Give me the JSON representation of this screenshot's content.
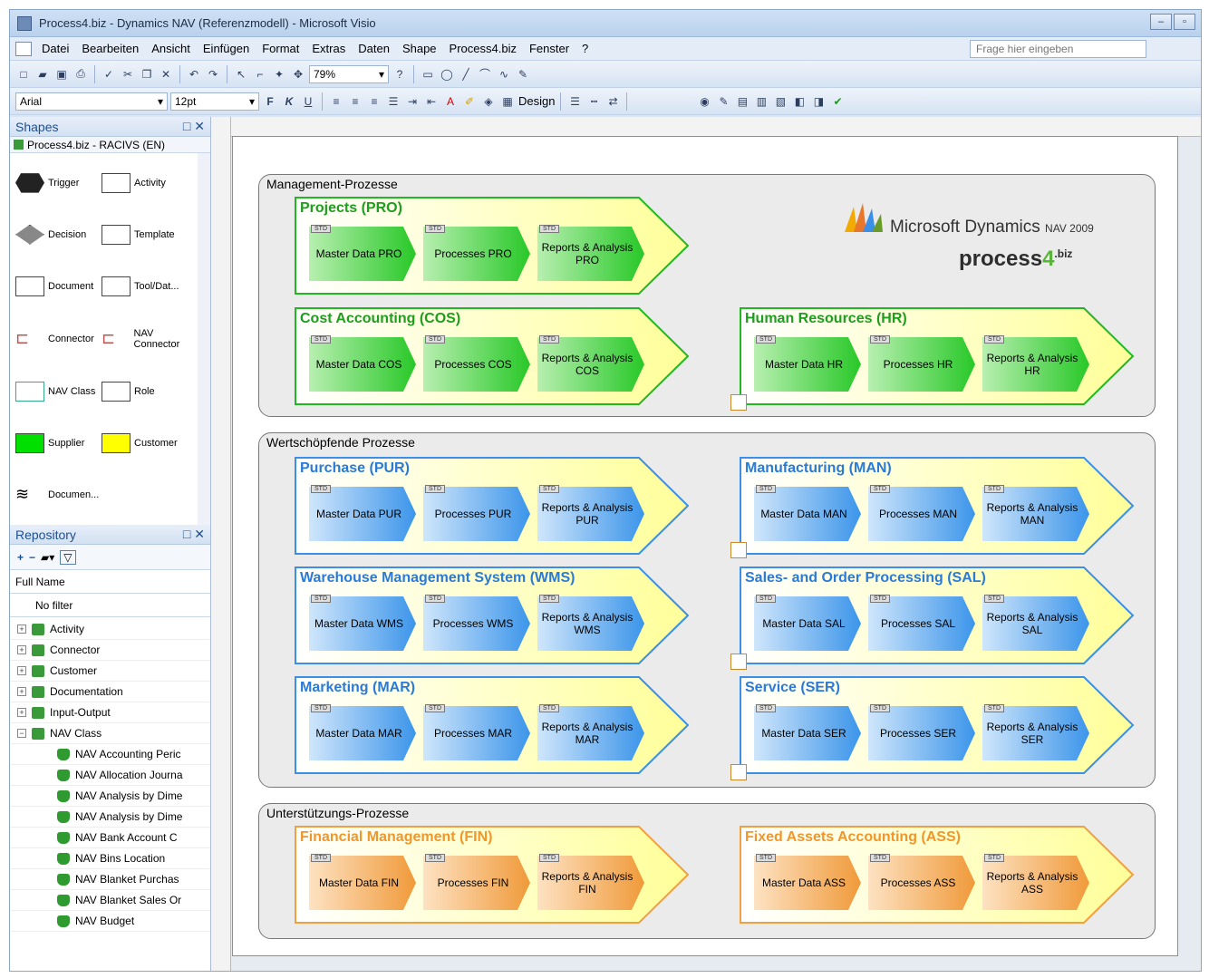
{
  "window": {
    "title": "Process4.biz - Dynamics NAV (Referenzmodell) - Microsoft Visio"
  },
  "menu": [
    "Datei",
    "Bearbeiten",
    "Ansicht",
    "Einfügen",
    "Format",
    "Extras",
    "Daten",
    "Shape",
    "Process4.biz",
    "Fenster",
    "?"
  ],
  "ask": {
    "placeholder": "Frage hier eingeben"
  },
  "toolbar": {
    "zoom": "79%",
    "font": "Arial",
    "size": "12pt",
    "design": "Design"
  },
  "shapes_panel": {
    "title": "Shapes",
    "stencil": "Process4.biz - RACIVS (EN)",
    "items": [
      "Trigger",
      "Activity",
      "Decision",
      "Template",
      "Document",
      "Tool/Dat...",
      "Connector",
      "NAV Connector",
      "NAV Class",
      "Role",
      "Supplier",
      "Customer",
      "Documen..."
    ]
  },
  "repository": {
    "title": "Repository",
    "column": "Full Name",
    "filter": "No filter",
    "groups": [
      "Activity",
      "Connector",
      "Customer",
      "Documentation",
      "Input-Output",
      "NAV Class"
    ],
    "classes": [
      "NAV Accounting Peric",
      "NAV Allocation Journa",
      "NAV Analysis by Dime",
      "NAV Analysis by Dime",
      "NAV Bank Account C",
      "NAV Bins Location",
      "NAV Blanket Purchas",
      "NAV Blanket Sales Or",
      "NAV Budget"
    ]
  },
  "diagram": {
    "groups": [
      {
        "label": "Management-Prozesse"
      },
      {
        "label": "Wertschöpfende Prozesse"
      },
      {
        "label": "Unterstützungs-Prozesse"
      }
    ],
    "logo": {
      "ms": "Microsoft Dynamics",
      "nav": "NAV 2009",
      "p4a": "process",
      "p4b": "4",
      "p4c": ".biz"
    },
    "std": "STD",
    "processes": [
      {
        "title": "Projects (PRO)",
        "color": "green",
        "boxes": [
          "Master Data PRO",
          "Processes PRO",
          "Reports & Analysis PRO"
        ]
      },
      {
        "title": "Cost Accounting (COS)",
        "color": "green",
        "boxes": [
          "Master Data  COS",
          "Processes COS",
          "Reports & Analysis COS"
        ]
      },
      {
        "title": "Human Resources (HR)",
        "color": "green",
        "boxes": [
          "Master Data HR",
          "Processes HR",
          "Reports & Analysis HR"
        ]
      },
      {
        "title": "Purchase (PUR)",
        "color": "blue",
        "boxes": [
          "Master Data PUR",
          "Processes PUR",
          "Reports & Analysis PUR"
        ]
      },
      {
        "title": "Manufacturing (MAN)",
        "color": "blue",
        "boxes": [
          "Master Data MAN",
          "Processes MAN",
          "Reports & Analysis MAN"
        ]
      },
      {
        "title": "Warehouse Management System (WMS)",
        "color": "blue",
        "boxes": [
          "Master Data WMS",
          "Processes WMS",
          "Reports & Analysis WMS"
        ]
      },
      {
        "title": "Sales- and Order Processing (SAL)",
        "color": "blue",
        "boxes": [
          "Master Data SAL",
          "Processes SAL",
          "Reports & Analysis SAL"
        ]
      },
      {
        "title": "Marketing (MAR)",
        "color": "blue",
        "boxes": [
          "Master Data MAR",
          "Processes MAR",
          "Reports & Analysis MAR"
        ]
      },
      {
        "title": "Service (SER)",
        "color": "blue",
        "boxes": [
          "Master Data SER",
          "Processes SER",
          "Reports & Analysis SER"
        ]
      },
      {
        "title": "Financial Management (FIN)",
        "color": "orange",
        "boxes": [
          "Master Data FIN",
          "Processes FIN",
          "Reports & Analysis FIN"
        ]
      },
      {
        "title": "Fixed Assets Accounting (ASS)",
        "color": "orange",
        "boxes": [
          "Master Data ASS",
          "Processes ASS",
          "Reports & Analysis ASS"
        ]
      }
    ]
  },
  "colors": {
    "green": {
      "border": "#22b822",
      "title": "#1e9e1e",
      "box1": "#28c828",
      "box2": "#b8efb0"
    },
    "blue": {
      "border": "#3b8fe6",
      "title": "#2a7ad8",
      "box1": "#3c95ea",
      "box2": "#cfe6fb"
    },
    "orange": {
      "border": "#f0a040",
      "title": "#f0962a",
      "box1": "#f09a3a",
      "box2": "#fde2c2"
    },
    "chevron_fill": "#ffff99"
  }
}
